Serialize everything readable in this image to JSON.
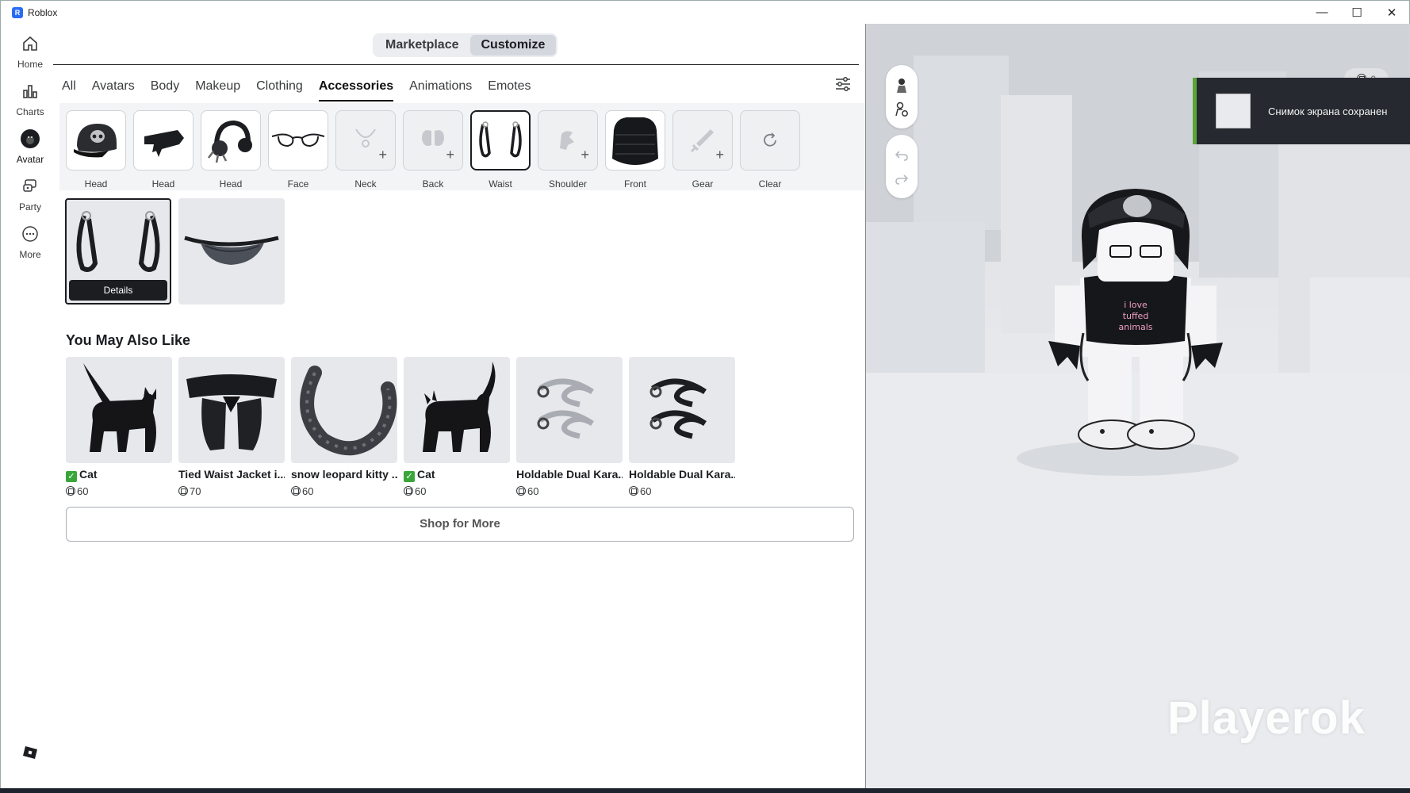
{
  "window": {
    "title": "Roblox",
    "minimize": "—",
    "maximize": "☐",
    "close": "✕"
  },
  "nav": [
    {
      "label": "Home",
      "icon": "home-icon"
    },
    {
      "label": "Charts",
      "icon": "charts-icon"
    },
    {
      "label": "Avatar",
      "icon": "avatar-icon"
    },
    {
      "label": "Party",
      "icon": "party-icon"
    },
    {
      "label": "More",
      "icon": "more-icon"
    }
  ],
  "mode_tabs": {
    "marketplace": "Marketplace",
    "customize": "Customize",
    "active": "Customize"
  },
  "category_tabs": [
    "All",
    "Avatars",
    "Body",
    "Makeup",
    "Clothing",
    "Accessories",
    "Animations",
    "Emotes"
  ],
  "active_category": "Accessories",
  "slots": [
    {
      "label": "Head",
      "state": "filled",
      "item": "skull-cap"
    },
    {
      "label": "Head",
      "state": "filled",
      "item": "black-hair-piece"
    },
    {
      "label": "Head",
      "state": "filled",
      "item": "spiked-headphones"
    },
    {
      "label": "Face",
      "state": "filled",
      "item": "glasses"
    },
    {
      "label": "Neck",
      "state": "empty"
    },
    {
      "label": "Back",
      "state": "empty"
    },
    {
      "label": "Waist",
      "state": "selected",
      "item": "waist-chains"
    },
    {
      "label": "Shoulder",
      "state": "empty"
    },
    {
      "label": "Front",
      "state": "filled",
      "item": "black-vest"
    },
    {
      "label": "Gear",
      "state": "empty"
    },
    {
      "label": "Clear",
      "state": "action"
    }
  ],
  "equipped": {
    "details_label": "Details"
  },
  "recommend": {
    "title": "You May Also Like",
    "items": [
      {
        "name": "Cat",
        "price": "60",
        "owned": true
      },
      {
        "name": "Tied Waist Jacket i...",
        "price": "70",
        "owned": false
      },
      {
        "name": "snow leopard kitty ...",
        "price": "60",
        "owned": false
      },
      {
        "name": "Cat",
        "price": "60",
        "owned": true
      },
      {
        "name": "Holdable Dual Kara...",
        "price": "60",
        "owned": false
      },
      {
        "name": "Holdable Dual Kara...",
        "price": "60",
        "owned": false
      }
    ],
    "shop_more": "Shop for More"
  },
  "viewport": {
    "toast": "Снимок экрана сохранен",
    "robux_balance": "0",
    "shirt_text": "i love tuffed animals",
    "watermark": "Playerok"
  }
}
